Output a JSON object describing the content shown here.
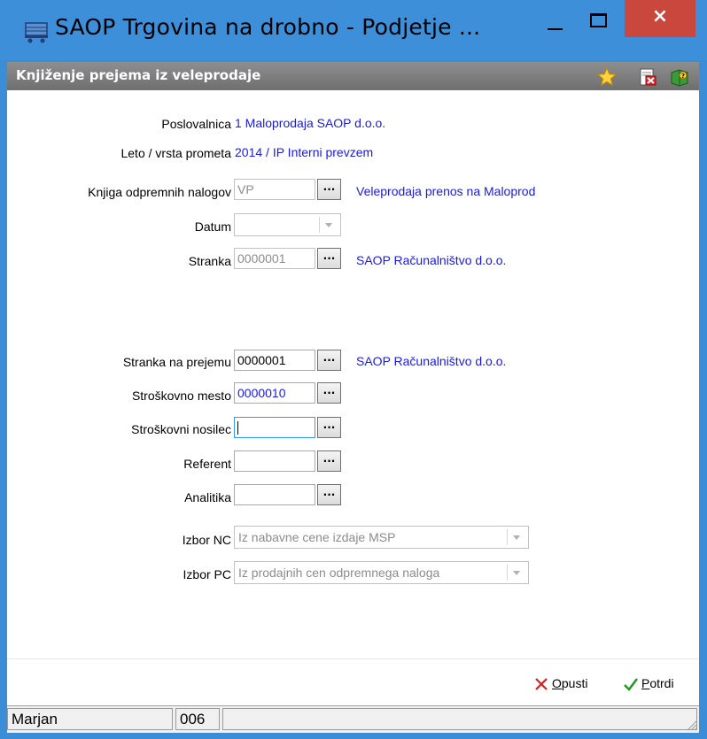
{
  "window": {
    "title": "SAOP Trgovina na drobno - Podjetje ...",
    "close_glyph": "×",
    "icons": {
      "app": "cart-icon",
      "minimize": "minimize-icon",
      "maximize": "maximize-icon",
      "close": "close-icon"
    }
  },
  "header": {
    "title": "Knjiženje prejema iz veleprodaje",
    "icons": [
      "star-icon",
      "delete-document-icon",
      "help-book-icon"
    ]
  },
  "form": {
    "poslovalnica": {
      "label": "Poslovalnica",
      "value": "1 Maloprodaja SAOP d.o.o."
    },
    "leto": {
      "label": "Leto / vrsta prometa",
      "value": "2014 / IP Interni prevzem"
    },
    "knjiga": {
      "label": "Knjiga odpremnih nalogov",
      "value": "VP",
      "description": "Veleprodaja prenos na Maloprod"
    },
    "datum": {
      "label": "Datum",
      "value": ""
    },
    "stranka": {
      "label": "Stranka",
      "value": "0000001",
      "description": "SAOP Računalništvo d.o.o."
    },
    "stranka_prejem": {
      "label": "Stranka na prejemu",
      "value": "0000001",
      "description": "SAOP Računalništvo d.o.o."
    },
    "strosk_mesto": {
      "label": "Stroškovno mesto",
      "value": "0000010"
    },
    "strosk_nosilec": {
      "label": "Stroškovni nosilec",
      "value": ""
    },
    "referent": {
      "label": "Referent",
      "value": ""
    },
    "analitika": {
      "label": "Analitika",
      "value": ""
    },
    "izbor_nc": {
      "label": "Izbor NC",
      "value": "Iz nabavne cene izdaje MSP"
    },
    "izbor_pc": {
      "label": "Izbor PC",
      "value": "Iz prodajnih cen odpremnega naloga"
    },
    "lookup_label": "..."
  },
  "buttons": {
    "opusti_first": "O",
    "opusti_rest": "pusti",
    "potrdi_first": "P",
    "potrdi_rest": "otrdi"
  },
  "status": {
    "user": "Marjan",
    "code": "006"
  },
  "colors": {
    "titlebar": "#3e8fd9",
    "close": "#c9473d",
    "info_text": "#1a1ae6",
    "header": "#7a7a7a"
  }
}
